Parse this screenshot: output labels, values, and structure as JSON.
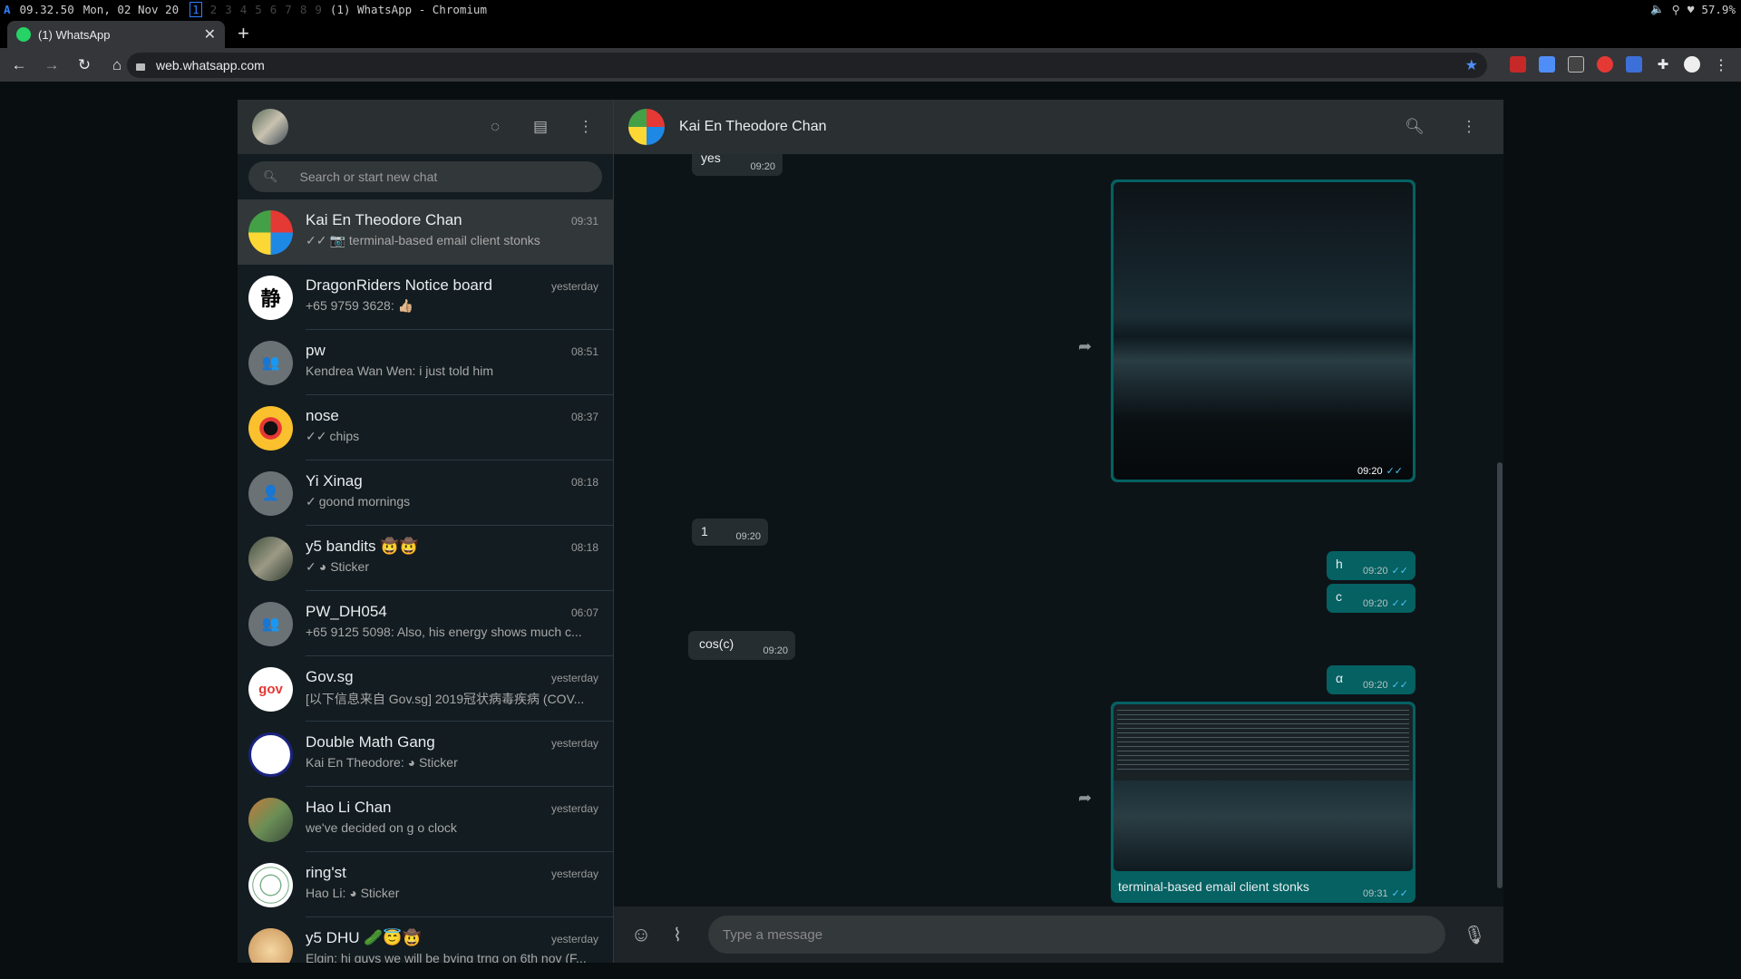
{
  "wmbar": {
    "logo": "A",
    "time": "09.32.50",
    "date": "Mon, 02 Nov 20",
    "workspaces": [
      "1",
      "2",
      "3",
      "4",
      "5",
      "6",
      "7",
      "8",
      "9"
    ],
    "window_title": "(1) WhatsApp - Chromium",
    "battery": "57.9%"
  },
  "browser": {
    "tab_title": "(1) WhatsApp",
    "url": "web.whatsapp.com"
  },
  "sidebar": {
    "search_placeholder": "Search or start new chat",
    "chats": [
      {
        "name": "Kai En Theodore Chan",
        "time": "09:31",
        "tick": "✓✓",
        "icon": "📷",
        "preview": "terminal-based email client stonks",
        "avatar": "cube"
      },
      {
        "name": "DragonRiders Notice board",
        "time": "yesterday",
        "tick": "",
        "icon": "",
        "preview": "+65 9759 3628: 👍🏼",
        "avatar": "glyph"
      },
      {
        "name": "pw",
        "time": "08:51",
        "tick": "",
        "icon": "",
        "preview": "Kendrea Wan Wen: i just told him",
        "avatar": "group"
      },
      {
        "name": "nose",
        "time": "08:37",
        "tick": "✓✓",
        "icon": "",
        "preview": "chips",
        "avatar": "nose"
      },
      {
        "name": "Yi Xinag",
        "time": "08:18",
        "tick": "✓",
        "icon": "",
        "preview": "goond mornings",
        "avatar": "person"
      },
      {
        "name": "y5 bandits 🤠🤠",
        "time": "08:18",
        "tick": "✓",
        "icon": "◕",
        "preview": "Sticker",
        "avatar": "photo"
      },
      {
        "name": "PW_DH054",
        "time": "06:07",
        "tick": "",
        "icon": "",
        "preview": "+65 9125 5098: Also, his energy shows much c...",
        "avatar": "group"
      },
      {
        "name": "Gov.sg",
        "time": "yesterday",
        "tick": "",
        "icon": "",
        "preview": "[以下信息来自 Gov.sg]  2019冠状病毒疾病 (COV...",
        "avatar": "gov"
      },
      {
        "name": "Double Math Gang",
        "time": "yesterday",
        "tick": "",
        "icon": "",
        "preview": "Kai En Theodore: ◕ Sticker",
        "avatar": "math"
      },
      {
        "name": "Hao Li Chan",
        "time": "yesterday",
        "tick": "",
        "icon": "",
        "preview": "we've decided on g o clock",
        "avatar": "photo2"
      },
      {
        "name": "ring'st",
        "time": "yesterday",
        "tick": "",
        "icon": "",
        "preview": "Hao Li: ◕ Sticker",
        "avatar": "ring"
      },
      {
        "name": "y5 DHU 🥒😇🤠",
        "time": "yesterday",
        "tick": "",
        "icon": "",
        "preview": "Elgin: hi guys we will be bying trng on 6th nov (F...",
        "avatar": "food"
      }
    ]
  },
  "main": {
    "contact_name": "Kai En Theodore Chan",
    "composer_placeholder": "Type a message",
    "messages": {
      "yes": {
        "text": "yes",
        "time": "09:20"
      },
      "img1": {
        "time": "09:20"
      },
      "one": {
        "text": "1",
        "time": "09:20"
      },
      "h": {
        "text": "h",
        "time": "09:20"
      },
      "c": {
        "text": "c",
        "time": "09:20"
      },
      "cos": {
        "text": "cos(c)",
        "time": "09:20"
      },
      "alpha": {
        "text": "α",
        "time": "09:20"
      },
      "img2": {
        "caption": "terminal-based email client stonks",
        "time": "09:31"
      }
    },
    "read_ticks": "✓✓"
  },
  "colors": {
    "accent_teal": "#056162",
    "incoming_bubble": "#262d31",
    "read_tick": "#4fc3f7"
  }
}
